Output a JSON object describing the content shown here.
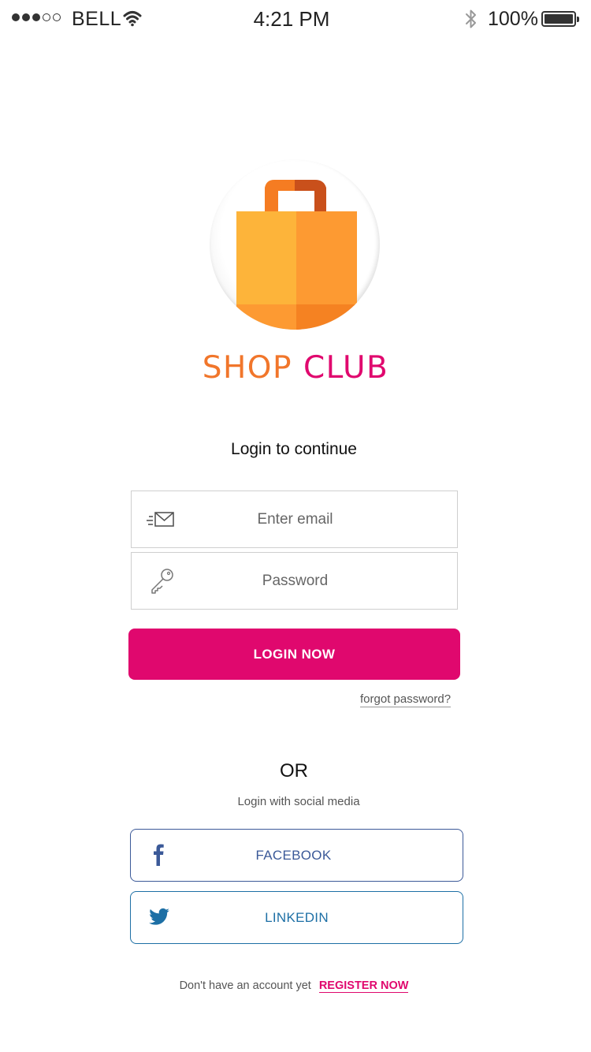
{
  "status_bar": {
    "carrier": "BELL",
    "time": "4:21 PM",
    "battery_percent": "100%",
    "signal_bars_filled": 3,
    "signal_bars_total": 5
  },
  "brand": {
    "word1": "SHOP",
    "word2": "CLUB",
    "colors": {
      "shop": "#f1762b",
      "club": "#e0086e"
    }
  },
  "login": {
    "heading": "Login to continue",
    "email_placeholder": "Enter email",
    "email_value": "",
    "email_icon": "envelope-icon",
    "password_placeholder": "Password",
    "password_value": "",
    "password_icon": "key-icon",
    "button_label": "LOGIN NOW",
    "button_color": "#e0086e",
    "forgot_label": "forgot password?"
  },
  "social": {
    "or_label": "OR",
    "caption": "Login with social media",
    "buttons": [
      {
        "label": "FACEBOOK",
        "icon": "facebook-icon",
        "color": "#3b5998"
      },
      {
        "label": "LINKEDIN",
        "icon": "twitter-bird-icon",
        "color": "#1d6fa5"
      }
    ]
  },
  "register": {
    "prompt": "Don't have an account yet",
    "link_label": "REGISTER NOW"
  }
}
